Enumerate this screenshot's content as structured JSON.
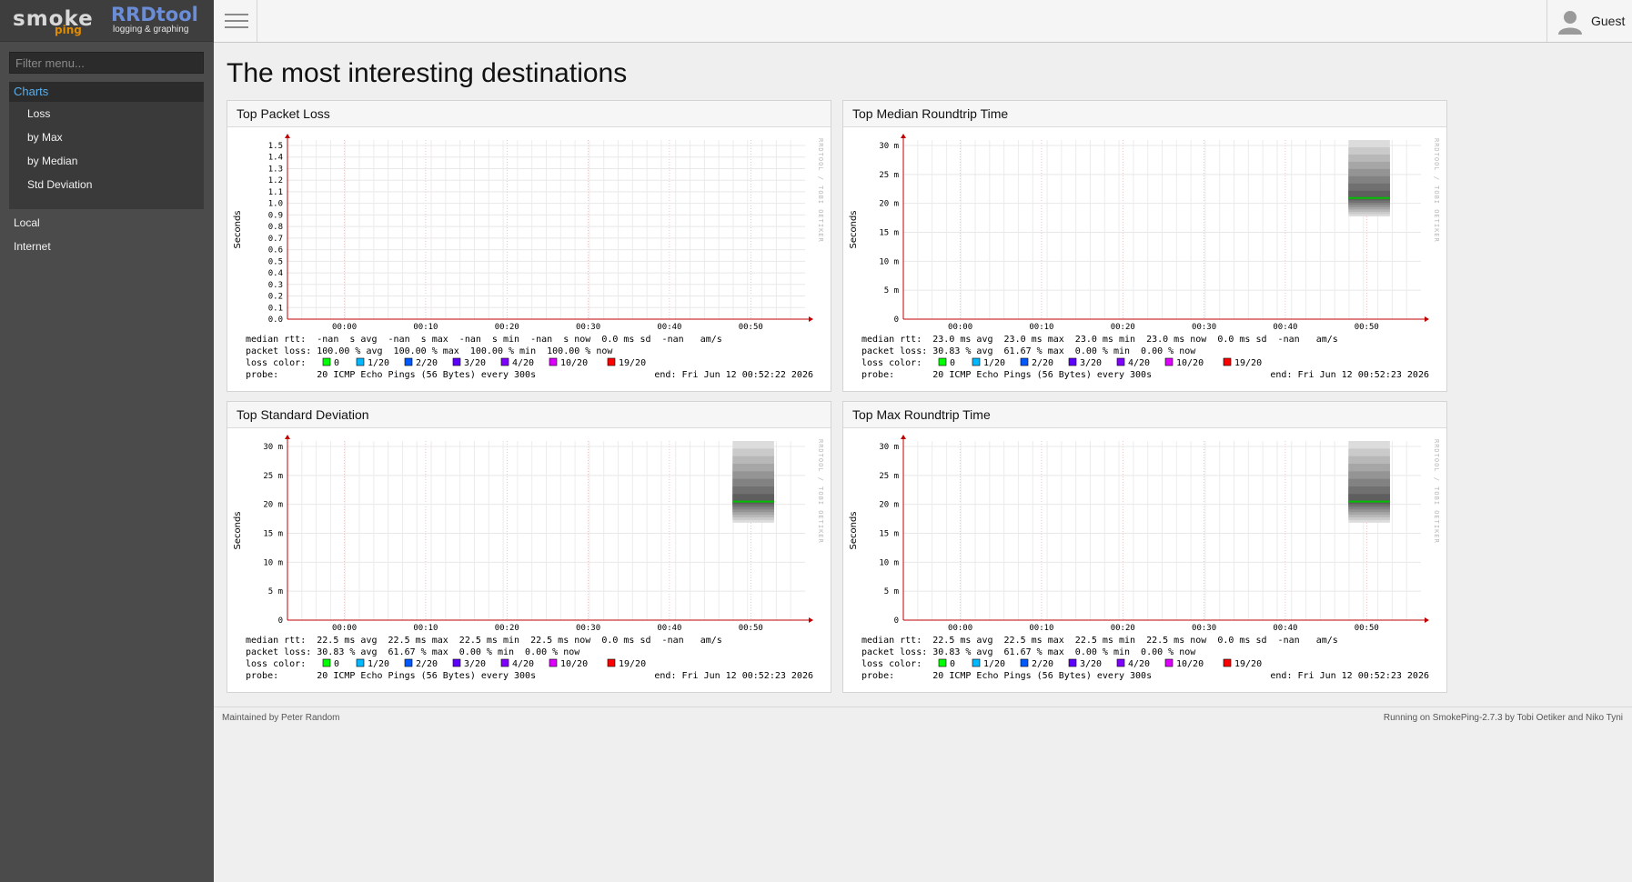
{
  "app": {
    "logo_primary": "smoke",
    "logo_accent": "ping",
    "logo_secondary": "RRDtool",
    "logo_tagline": "logging & graphing"
  },
  "sidebar": {
    "filter_placeholder": "Filter menu...",
    "charts_label": "Charts",
    "chart_items": [
      "Loss",
      "by Max",
      "by Median",
      "Std Deviation"
    ],
    "other_items": [
      "Local",
      "Internet"
    ]
  },
  "topbar": {
    "user_label": "Guest",
    "menu_icon": "hamburger-icon",
    "user_icon": "user-icon"
  },
  "page": {
    "title": "The most interesting destinations"
  },
  "footer": {
    "left": "Maintained by Peter Random",
    "right": "Running on SmokePing-2.7.3 by Tobi Oetiker and Niko Tyni"
  },
  "colors": {
    "median_line": "#00c000",
    "smoke": "#888888",
    "axis": "#c00000",
    "loss_legend": [
      "#00ff00",
      "#00b8ff",
      "#0059ff",
      "#5e00ff",
      "#7e00ff",
      "#dd00ff",
      "#ff0000"
    ]
  },
  "chart_data": [
    {
      "type": "area",
      "title": "Top Packet Loss",
      "ylabel": "Seconds",
      "x_ticks": [
        "00:00",
        "00:10",
        "00:20",
        "00:30",
        "00:40",
        "00:50"
      ],
      "y_ticks": [
        "1.5",
        "1.4",
        "1.3",
        "1.2",
        "1.1",
        "1.0",
        "0.9",
        "0.8",
        "0.7",
        "0.6",
        "0.5",
        "0.4",
        "0.3",
        "0.2",
        "0.1",
        "0.0"
      ],
      "ylim": [
        0,
        1.5
      ],
      "smoke": null,
      "watermark": "RRDTOOL / TOBI OETIKER",
      "legend": [
        "median rtt:  -nan  s avg  -nan  s max  -nan  s min  -nan  s now  0.0 ms sd  -nan   am/s",
        "packet loss: 100.00 % avg  100.00 % max  100.00 % min  100.00 % now",
        "loss color:",
        "probe:       20 ICMP Echo Pings (56 Bytes) every 300s"
      ],
      "loss_labels": [
        "0",
        "1/20",
        "2/20",
        "3/20",
        "4/20",
        "10/20",
        "19/20"
      ],
      "end": "end: Fri Jun 12 00:52:22 2026"
    },
    {
      "type": "area",
      "title": "Top Median Roundtrip Time",
      "ylabel": "Seconds",
      "x_ticks": [
        "00:00",
        "00:10",
        "00:20",
        "00:30",
        "00:40",
        "00:50"
      ],
      "y_ticks": [
        "30 m",
        "25 m",
        "20 m",
        "15 m",
        "10 m",
        "5 m",
        "0"
      ],
      "ylim": [
        0,
        34
      ],
      "smoke": {
        "x_range": [
          0.86,
          0.94
        ],
        "min": 19.5,
        "max": 34,
        "median": 23.0
      },
      "watermark": "RRDTOOL / TOBI OETIKER",
      "legend": [
        "median rtt:  23.0 ms avg  23.0 ms max  23.0 ms min  23.0 ms now  0.0 ms sd  -nan   am/s",
        "packet loss: 30.83 % avg  61.67 % max  0.00 % min  0.00 % now",
        "loss color:",
        "probe:       20 ICMP Echo Pings (56 Bytes) every 300s"
      ],
      "loss_labels": [
        "0",
        "1/20",
        "2/20",
        "3/20",
        "4/20",
        "10/20",
        "19/20"
      ],
      "end": "end: Fri Jun 12 00:52:23 2026"
    },
    {
      "type": "area",
      "title": "Top Standard Deviation",
      "ylabel": "Seconds",
      "x_ticks": [
        "00:00",
        "00:10",
        "00:20",
        "00:30",
        "00:40",
        "00:50"
      ],
      "y_ticks": [
        "30 m",
        "25 m",
        "20 m",
        "15 m",
        "10 m",
        "5 m",
        "0"
      ],
      "ylim": [
        0,
        34
      ],
      "smoke": {
        "x_range": [
          0.86,
          0.94
        ],
        "min": 18.5,
        "max": 34,
        "median": 22.5
      },
      "watermark": "RRDTOOL / TOBI OETIKER",
      "legend": [
        "median rtt:  22.5 ms avg  22.5 ms max  22.5 ms min  22.5 ms now  0.0 ms sd  -nan   am/s",
        "packet loss: 30.83 % avg  61.67 % max  0.00 % min  0.00 % now",
        "loss color:",
        "probe:       20 ICMP Echo Pings (56 Bytes) every 300s"
      ],
      "loss_labels": [
        "0",
        "1/20",
        "2/20",
        "3/20",
        "4/20",
        "10/20",
        "19/20"
      ],
      "end": "end: Fri Jun 12 00:52:23 2026"
    },
    {
      "type": "area",
      "title": "Top Max Roundtrip Time",
      "ylabel": "Seconds",
      "x_ticks": [
        "00:00",
        "00:10",
        "00:20",
        "00:30",
        "00:40",
        "00:50"
      ],
      "y_ticks": [
        "30 m",
        "25 m",
        "20 m",
        "15 m",
        "10 m",
        "5 m",
        "0"
      ],
      "ylim": [
        0,
        34
      ],
      "smoke": {
        "x_range": [
          0.86,
          0.94
        ],
        "min": 18.5,
        "max": 34,
        "median": 22.5
      },
      "watermark": "RRDTOOL / TOBI OETIKER",
      "legend": [
        "median rtt:  22.5 ms avg  22.5 ms max  22.5 ms min  22.5 ms now  0.0 ms sd  -nan   am/s",
        "packet loss: 30.83 % avg  61.67 % max  0.00 % min  0.00 % now",
        "loss color:",
        "probe:       20 ICMP Echo Pings (56 Bytes) every 300s"
      ],
      "loss_labels": [
        "0",
        "1/20",
        "2/20",
        "3/20",
        "4/20",
        "10/20",
        "19/20"
      ],
      "end": "end: Fri Jun 12 00:52:23 2026"
    }
  ]
}
